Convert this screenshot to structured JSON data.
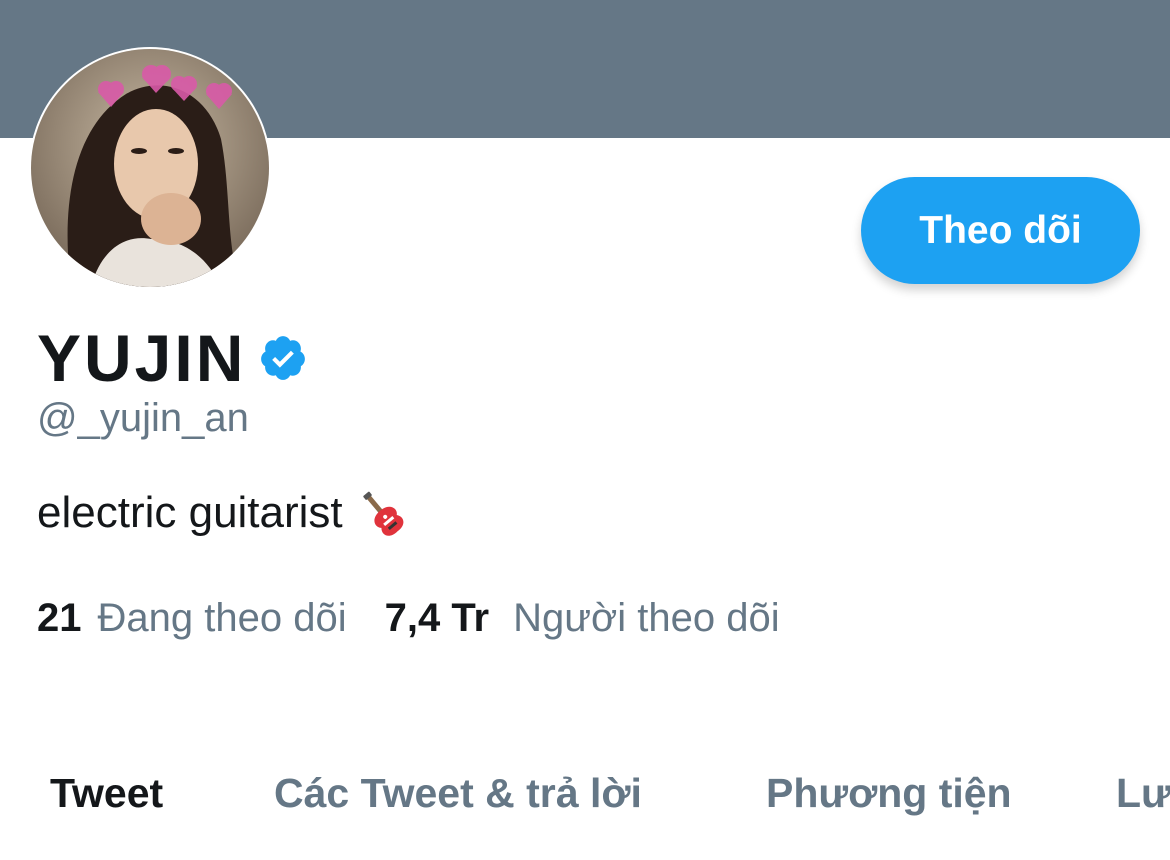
{
  "profile": {
    "display_name": "YUJIN",
    "handle": "@_yujin_an",
    "bio": "electric guitarist",
    "follow_button": "Theo dõi"
  },
  "stats": {
    "following_count": "21",
    "following_label": "Đang theo dõi",
    "followers_count": "7,4 Tr",
    "followers_label": "Người theo dõi"
  },
  "tabs": [
    {
      "label": "Tweet",
      "active": true
    },
    {
      "label": "Các Tweet & trả lời",
      "active": false
    },
    {
      "label": "Phương tiện",
      "active": false
    },
    {
      "label": "Lươ",
      "active": false
    }
  ],
  "colors": {
    "banner": "#657786",
    "accent": "#1da1f2",
    "text_primary": "#14171a",
    "text_secondary": "#657786"
  },
  "icons": {
    "verified": "verified-badge-icon",
    "guitar": "guitar-emoji-icon"
  }
}
